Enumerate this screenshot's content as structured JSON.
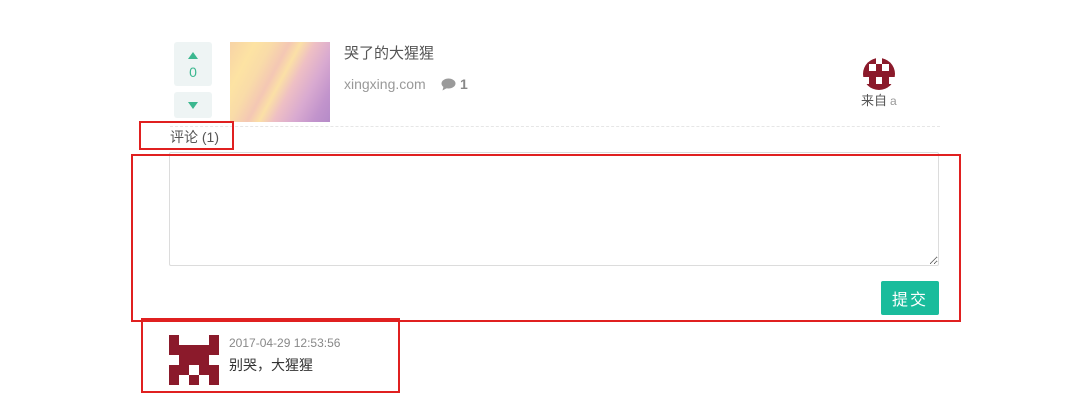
{
  "post": {
    "vote_count": "0",
    "title": "哭了的大猩猩",
    "domain": "xingxing.com",
    "comment_count": "1",
    "author_prefix": "来自",
    "author_name": "a"
  },
  "comments_section": {
    "header": "评论 (1)",
    "submit_label": "提交"
  },
  "comments": [
    {
      "timestamp": "2017-04-29 12:53:56",
      "text": "别哭，大猩猩"
    }
  ],
  "icons": {
    "upvote": "triangle-up-icon",
    "downvote": "triangle-down-icon",
    "comments": "speech-bubble-icon",
    "author_avatar": "identicon-avatar",
    "comment_avatar": "identicon-avatar"
  },
  "colors": {
    "accent": "#1abc9c",
    "vote_arrow": "#3bb78f",
    "identicon": "#8b1a2b",
    "highlight_box": "#e02020"
  }
}
